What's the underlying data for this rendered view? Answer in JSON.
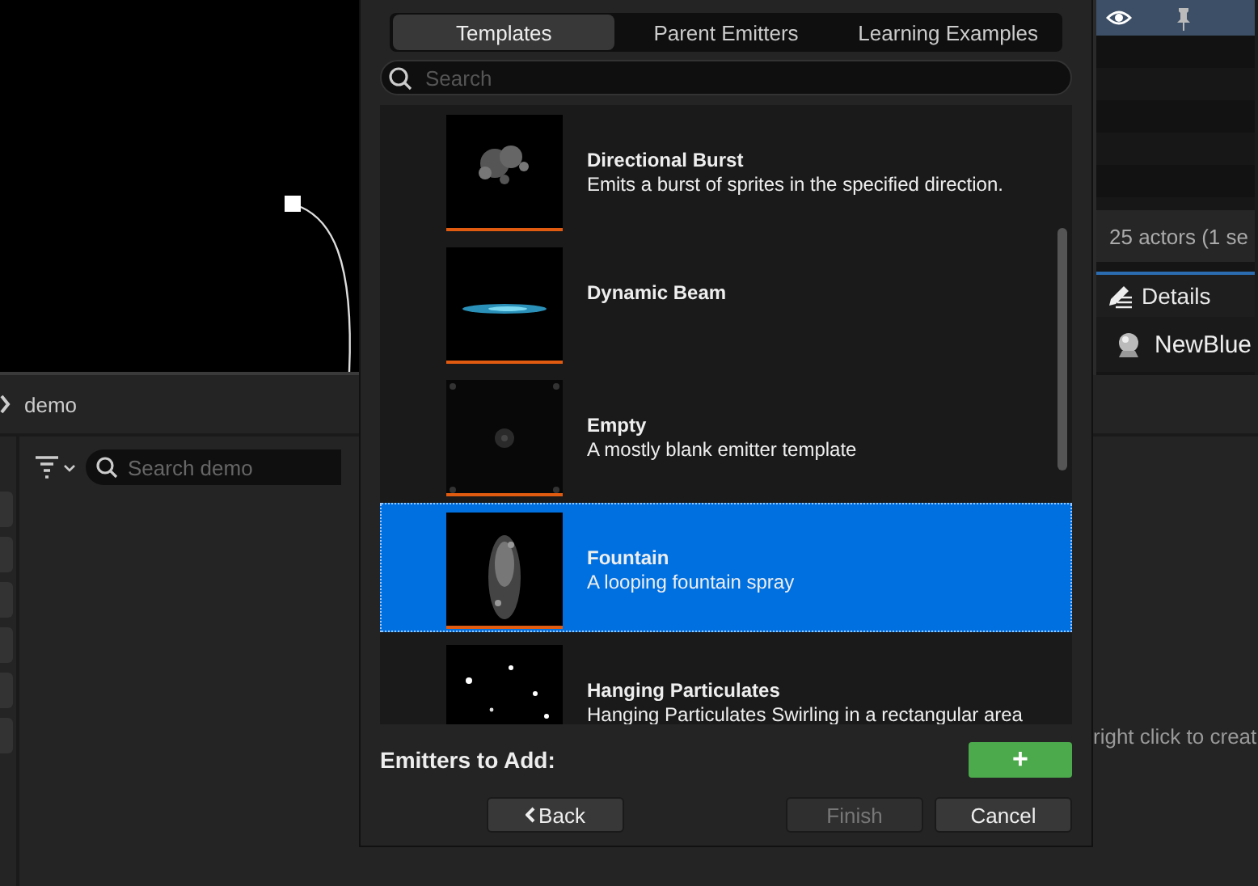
{
  "outliner": {
    "status": "25 actors (1 se"
  },
  "details": {
    "tab": "Details",
    "object": "NewBlue"
  },
  "content_browser": {
    "breadcrumb": "demo",
    "search": {
      "placeholder": "Search demo"
    },
    "hint": "right click to creat"
  },
  "dialog": {
    "tabs": [
      {
        "label": "Templates",
        "selected": true
      },
      {
        "label": "Parent Emitters",
        "selected": false
      },
      {
        "label": "Learning Examples",
        "selected": false
      }
    ],
    "search": {
      "placeholder": "Search"
    },
    "templates": [
      {
        "title": "Directional Burst",
        "description": "Emits a burst of sprites in the specified direction.",
        "selected": false
      },
      {
        "title": "Dynamic Beam",
        "selected": false
      },
      {
        "title": "Empty",
        "description": "A mostly blank emitter template",
        "selected": false
      },
      {
        "title": "Fountain",
        "description": "A looping fountain spray",
        "selected": true
      },
      {
        "title": "Hanging Particulates",
        "description": "Hanging Particulates Swirling in a rectangular area",
        "selected": false
      }
    ],
    "emitters_label": "Emitters to Add:",
    "add_button": "+",
    "buttons": [
      {
        "label": "Back",
        "kind": "back",
        "disabled": false
      },
      {
        "label": "Finish",
        "kind": "plain",
        "disabled": true
      },
      {
        "label": "Cancel",
        "kind": "plain",
        "disabled": false
      }
    ]
  }
}
